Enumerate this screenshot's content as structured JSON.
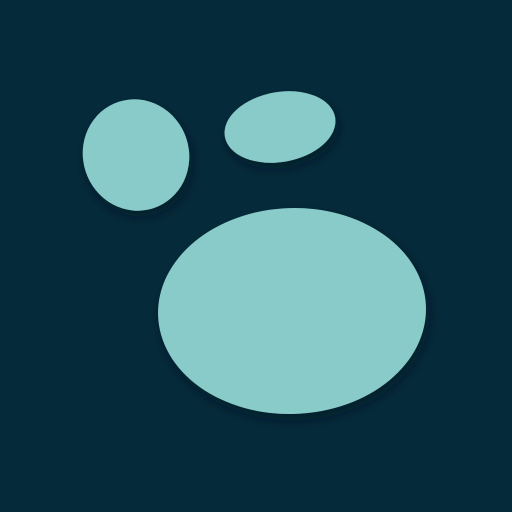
{
  "icon": {
    "name": "paw-print-icon",
    "colors": {
      "background": "#052a3a",
      "shape": "#89cbc9",
      "shadow": "#001520"
    }
  }
}
